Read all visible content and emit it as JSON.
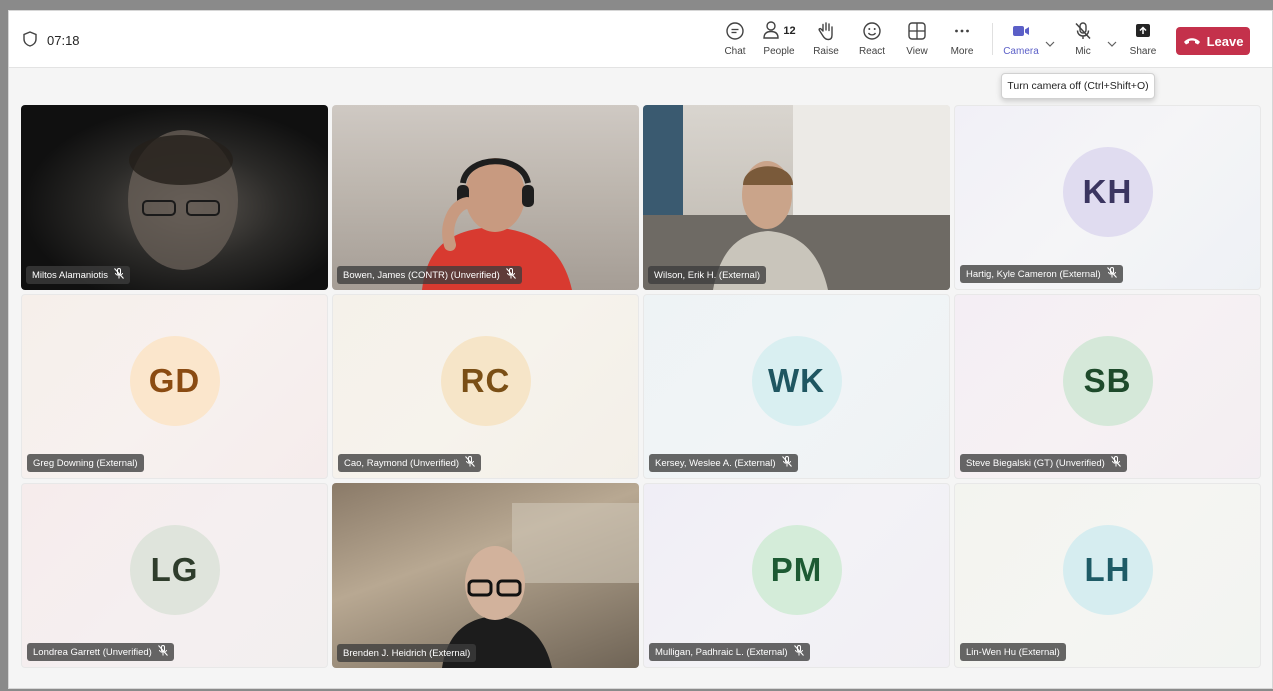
{
  "meeting": {
    "timer": "07:18",
    "toolbar": {
      "chat": "Chat",
      "people": "People",
      "people_count": "12",
      "raise": "Raise",
      "react": "React",
      "view": "View",
      "more": "More",
      "camera": "Camera",
      "mic": "Mic",
      "share": "Share",
      "leave": "Leave"
    },
    "tooltip": "Turn camera off (Ctrl+Shift+O)",
    "accent_color": "#5b5fc7",
    "leave_color": "#c4314b"
  },
  "participants": [
    {
      "name": "Miltos Alamaniotis",
      "muted": true,
      "video": true
    },
    {
      "name": "Bowen, James (CONTR) (Unverified)",
      "muted": true,
      "video": true
    },
    {
      "name": "Wilson, Erik H. (External)",
      "muted": false,
      "video": true
    },
    {
      "name": "Hartig, Kyle Cameron (External)",
      "muted": true,
      "initials": "KH"
    },
    {
      "name": "Greg Downing (External)",
      "muted": false,
      "initials": "GD"
    },
    {
      "name": "Cao, Raymond (Unverified)",
      "muted": true,
      "initials": "RC"
    },
    {
      "name": "Kersey, Weslee A. (External)",
      "muted": true,
      "initials": "WK"
    },
    {
      "name": "Steve Biegalski (GT) (Unverified)",
      "muted": true,
      "initials": "SB"
    },
    {
      "name": "Londrea Garrett (Unverified)",
      "muted": true,
      "initials": "LG"
    },
    {
      "name": "Brenden J. Heidrich (External)",
      "muted": false,
      "video": true
    },
    {
      "name": "Mulligan, Padhraic L. (External)",
      "muted": true,
      "initials": "PM"
    },
    {
      "name": "Lin-Wen Hu (External)",
      "muted": false,
      "initials": "LH"
    }
  ]
}
